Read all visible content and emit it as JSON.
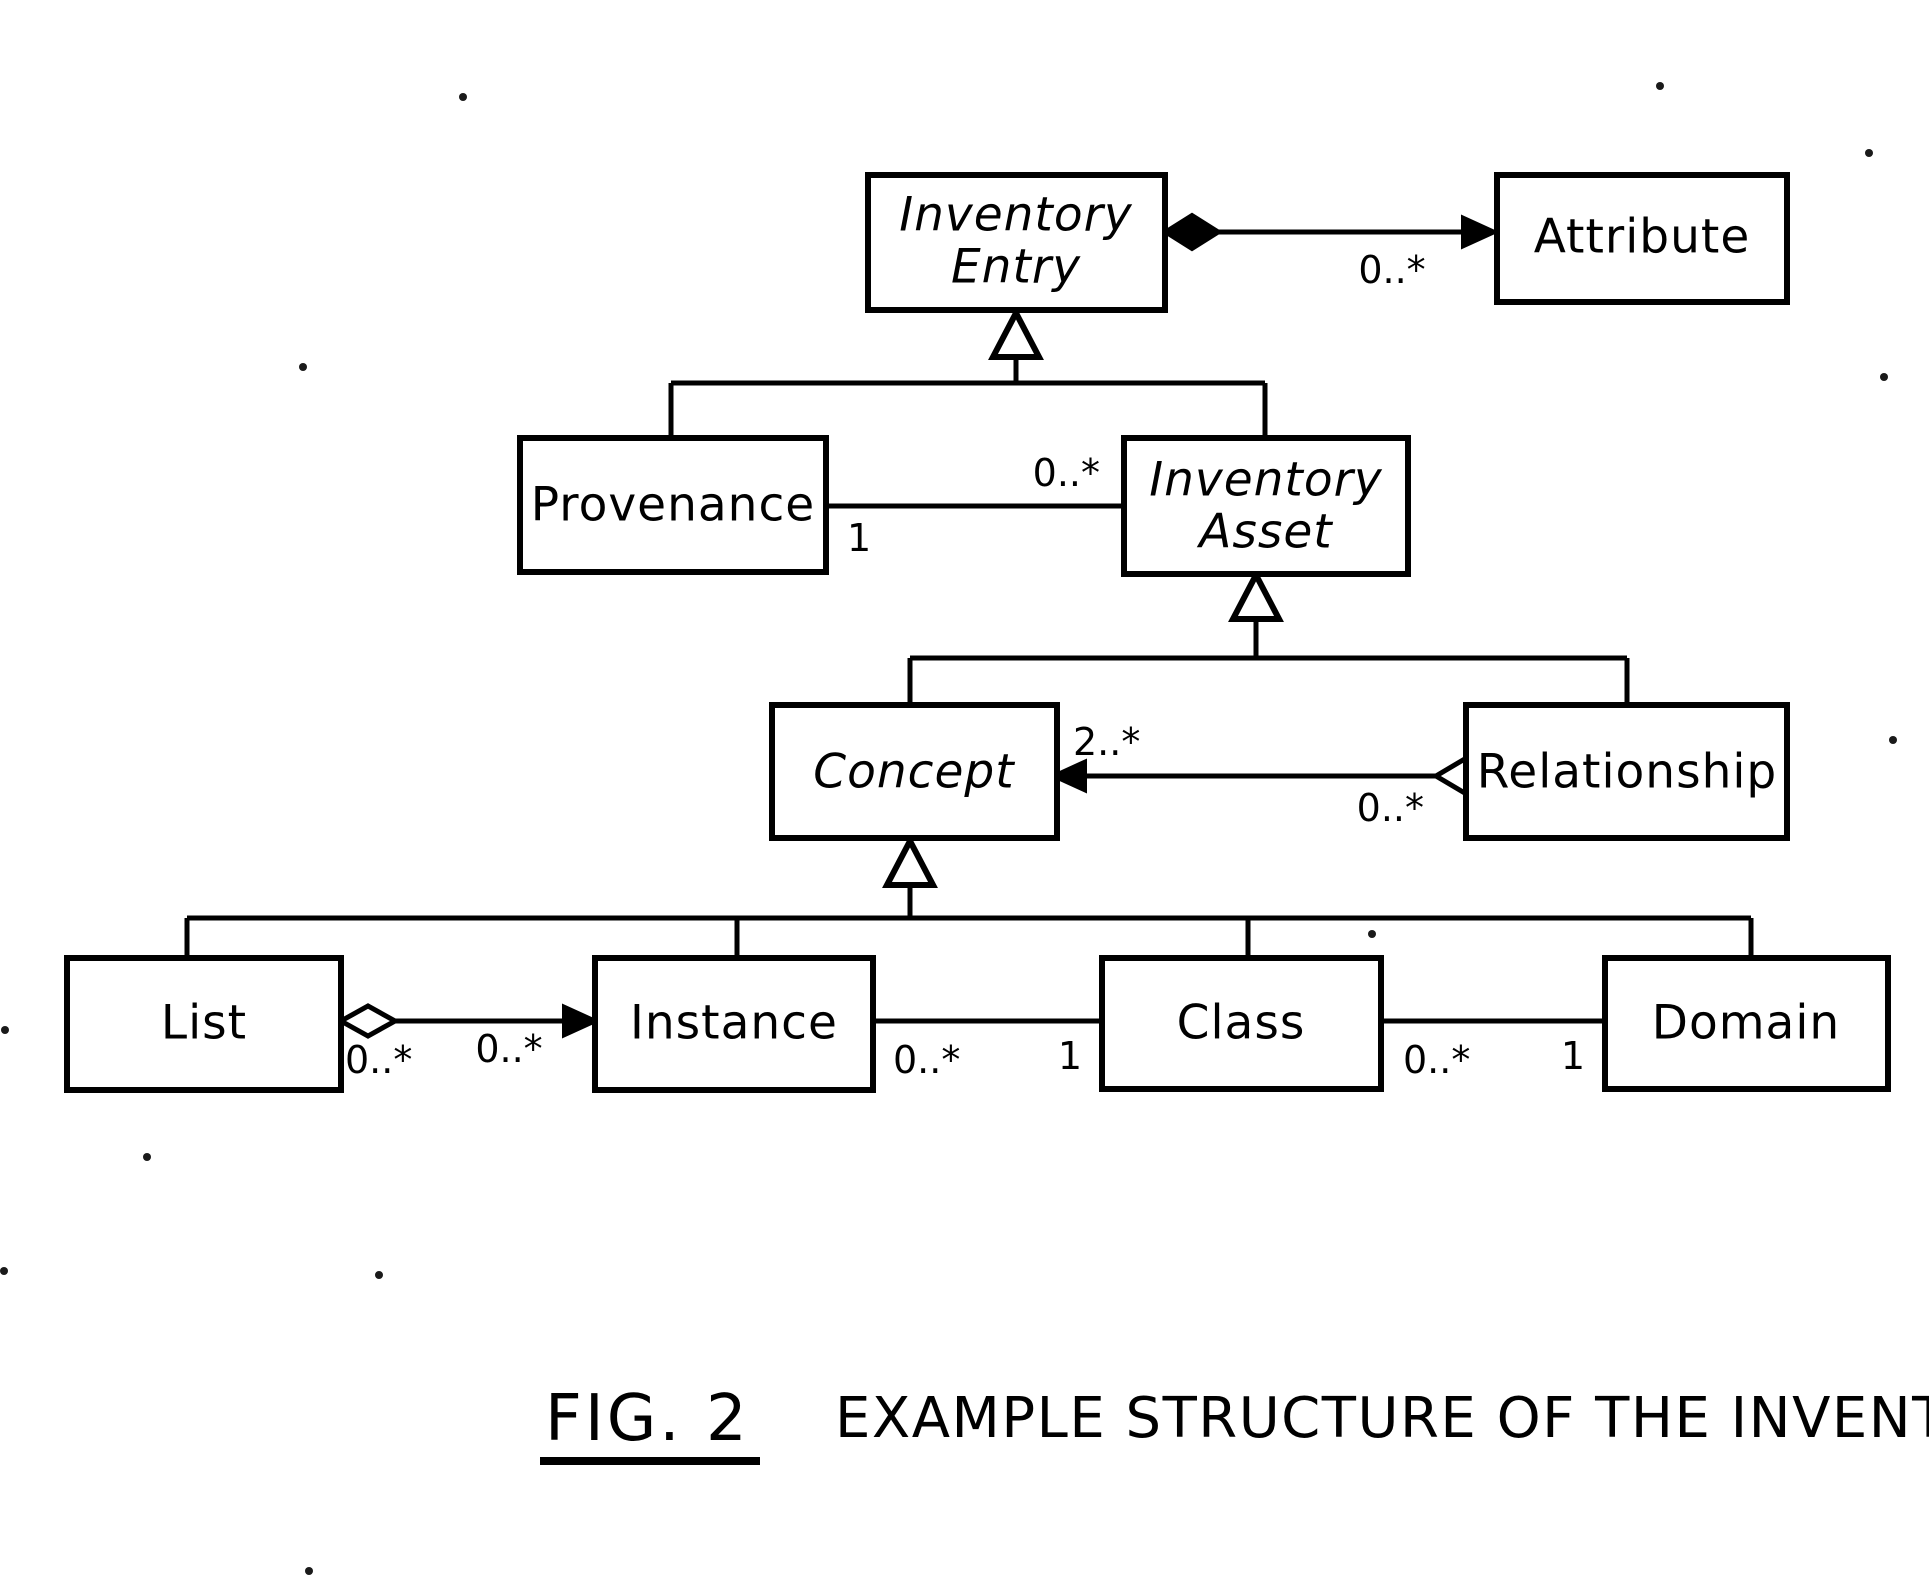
{
  "figure": {
    "label": "FIG. 2",
    "caption": "EXAMPLE STRUCTURE OF THE INVENTORY"
  },
  "diagram": {
    "type": "uml-class-diagram",
    "title": "Example structure of the inventory",
    "stroke_color": "#000000",
    "fill_color": "#ffffff",
    "background": "#ffffff",
    "classes": [
      {
        "id": "inventory_entry",
        "name": "Inventory Entry",
        "name_line1": "Inventory",
        "name_line2": "Entry",
        "abstract": true
      },
      {
        "id": "attribute",
        "name": "Attribute",
        "abstract": false
      },
      {
        "id": "provenance",
        "name": "Provenance",
        "abstract": false
      },
      {
        "id": "inventory_asset",
        "name": "Inventory Asset",
        "name_line1": "Inventory",
        "name_line2": "Asset",
        "abstract": true
      },
      {
        "id": "concept",
        "name": "Concept",
        "abstract": true
      },
      {
        "id": "relationship",
        "name": "Relationship",
        "abstract": false
      },
      {
        "id": "list",
        "name": "List",
        "abstract": false
      },
      {
        "id": "instance",
        "name": "Instance",
        "abstract": false
      },
      {
        "id": "class",
        "name": "Class",
        "abstract": false
      },
      {
        "id": "domain",
        "name": "Domain",
        "abstract": false
      }
    ],
    "relations": [
      {
        "id": "entry_attribute",
        "from": "inventory_entry",
        "to": "attribute",
        "kind": "composition",
        "source_decoration": "filled-diamond",
        "target_decoration": "arrow",
        "target_multiplicity": "0..*"
      },
      {
        "id": "entry_provenance_gen",
        "from": "provenance",
        "to": "inventory_entry",
        "kind": "generalization",
        "target_decoration": "hollow-triangle"
      },
      {
        "id": "entry_asset_gen",
        "from": "inventory_asset",
        "to": "inventory_entry",
        "kind": "generalization",
        "target_decoration": "hollow-triangle"
      },
      {
        "id": "provenance_asset",
        "from": "provenance",
        "to": "inventory_asset",
        "kind": "association",
        "source_multiplicity": "1",
        "target_multiplicity": "0..*"
      },
      {
        "id": "asset_concept_gen",
        "from": "concept",
        "to": "inventory_asset",
        "kind": "generalization",
        "target_decoration": "hollow-triangle"
      },
      {
        "id": "asset_relationship_gen",
        "from": "relationship",
        "to": "inventory_asset",
        "kind": "generalization",
        "target_decoration": "hollow-triangle"
      },
      {
        "id": "relationship_concept",
        "from": "relationship",
        "to": "concept",
        "kind": "aggregation",
        "source_decoration": "hollow-diamond",
        "target_decoration": "arrow",
        "source_multiplicity": "0..*",
        "target_multiplicity": "2..*"
      },
      {
        "id": "concept_list_gen",
        "from": "list",
        "to": "concept",
        "kind": "generalization",
        "target_decoration": "hollow-triangle"
      },
      {
        "id": "concept_instance_gen",
        "from": "instance",
        "to": "concept",
        "kind": "generalization",
        "target_decoration": "hollow-triangle"
      },
      {
        "id": "concept_class_gen",
        "from": "class",
        "to": "concept",
        "kind": "generalization",
        "target_decoration": "hollow-triangle"
      },
      {
        "id": "concept_domain_gen",
        "from": "domain",
        "to": "concept",
        "kind": "generalization",
        "target_decoration": "hollow-triangle"
      },
      {
        "id": "list_instance",
        "from": "list",
        "to": "instance",
        "kind": "aggregation",
        "source_decoration": "hollow-diamond",
        "target_decoration": "arrow",
        "source_multiplicity": "0..*",
        "target_multiplicity": "0..*"
      },
      {
        "id": "instance_class",
        "from": "instance",
        "to": "class",
        "kind": "association",
        "source_multiplicity": "0..*",
        "target_multiplicity": "1"
      },
      {
        "id": "class_domain",
        "from": "class",
        "to": "domain",
        "kind": "association",
        "source_multiplicity": "0..*",
        "target_multiplicity": "1"
      }
    ],
    "multiplicity_labels": {
      "entry_attribute_target": "0..*",
      "provenance_source": "1",
      "asset_target": "0..*",
      "concept_target": "2..*",
      "relationship_source": "0..*",
      "list_source": "0..*",
      "instance_from_list": "0..*",
      "instance_to_class": "0..*",
      "class_from_instance": "1",
      "class_to_domain": "0..*",
      "domain_from_class": "1"
    }
  }
}
